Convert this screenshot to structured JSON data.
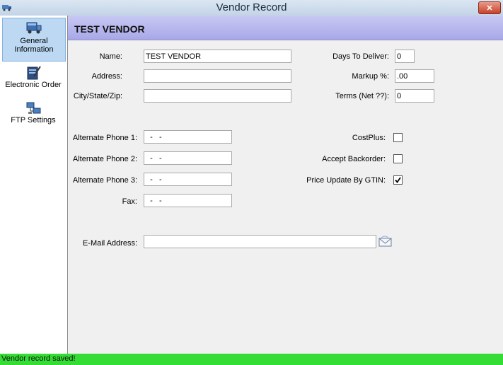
{
  "window": {
    "title": "Vendor Record",
    "close_label": "✕"
  },
  "sidebar": {
    "items": [
      {
        "label": "General Information",
        "selected": true
      },
      {
        "label": "Electronic Order",
        "selected": false
      },
      {
        "label": "FTP Settings",
        "selected": false
      }
    ]
  },
  "header": {
    "vendor_name": "TEST VENDOR"
  },
  "form": {
    "name": {
      "label": "Name:",
      "value": "TEST VENDOR"
    },
    "address": {
      "label": "Address:",
      "value": ""
    },
    "city_state_zip": {
      "label": "City/State/Zip:",
      "value": ""
    },
    "days_to_deliver": {
      "label": "Days To Deliver:",
      "value": "0"
    },
    "markup": {
      "label": "Markup %:",
      "value": ".00"
    },
    "terms": {
      "label": "Terms (Net ??):",
      "value": "0"
    },
    "alt_phone_1": {
      "label": "Alternate Phone 1:",
      "value": "  -   -"
    },
    "alt_phone_2": {
      "label": "Alternate Phone 2:",
      "value": "  -   -"
    },
    "alt_phone_3": {
      "label": "Alternate Phone 3:",
      "value": "  -   -"
    },
    "fax": {
      "label": "Fax:",
      "value": "  -   -"
    },
    "costplus": {
      "label": "CostPlus:",
      "checked": false
    },
    "accept_backorder": {
      "label": "Accept Backorder:",
      "checked": false
    },
    "price_update_gtin": {
      "label": "Price Update By GTIN:",
      "checked": true
    },
    "email": {
      "label": "E-Mail Address:",
      "value": ""
    }
  },
  "status": {
    "text": "Vendor record saved!",
    "color": "#33dd33"
  }
}
